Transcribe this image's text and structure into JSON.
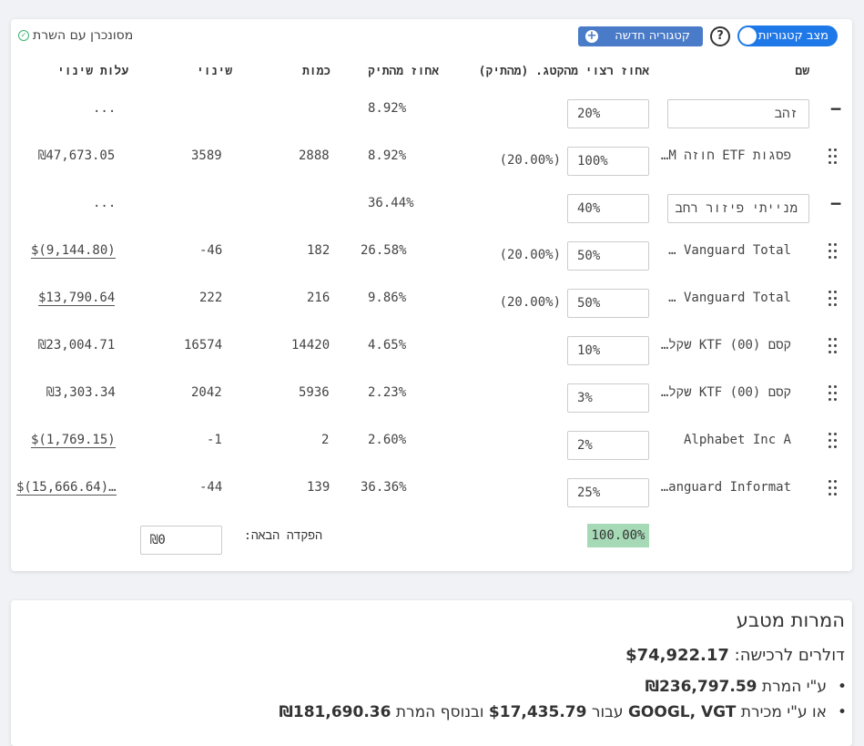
{
  "header": {
    "toggle_label": "מצב קטגוריות",
    "new_category_label": "קטגוריה חדשה",
    "help_symbol": "?",
    "sync_status": "מסונכרן עם השרת"
  },
  "columns": {
    "name": "שם",
    "desired_pct": "אחוז רצוי מהקטג. (מהתיק)",
    "portfolio_pct": "אחוז מהתיק",
    "quantity": "כמות",
    "change": "שינוי",
    "change_cost": "עלות שינוי"
  },
  "rows": [
    {
      "type": "category",
      "name": "זהב",
      "desired": "20%",
      "portfolio_pct": "8.92%",
      "change_cost": "..."
    },
    {
      "type": "holding",
      "name": "פסגות ETF חוזה M…",
      "desired": "100%",
      "sub": "(20.00%)",
      "portfolio_pct": "8.92%",
      "quantity": "2888",
      "change": "3589",
      "change_cost": "₪47,673.05"
    },
    {
      "type": "category",
      "name": "מנייתי פיזור רחב",
      "desired": "40%",
      "portfolio_pct": "36.44%",
      "change_cost": "..."
    },
    {
      "type": "holding",
      "name": "Vanguard Total …",
      "desired": "50%",
      "sub": "(20.00%)",
      "portfolio_pct": "26.58%",
      "quantity": "182",
      "change": "-46",
      "change_cost": "$(9,144.80)"
    },
    {
      "type": "holding",
      "name": "Vanguard Total …",
      "desired": "50%",
      "sub": "(20.00%)",
      "portfolio_pct": "9.86%",
      "quantity": "216",
      "change": "222",
      "change_cost": "$13,790.64"
    },
    {
      "type": "holding",
      "name": "קסם KTF (00) שקלי…",
      "desired": "10%",
      "portfolio_pct": "4.65%",
      "quantity": "14420",
      "change": "16574",
      "change_cost": "₪23,004.71"
    },
    {
      "type": "holding",
      "name": "קסם KTF (00) שקלי…",
      "desired": "3%",
      "portfolio_pct": "2.23%",
      "quantity": "5936",
      "change": "2042",
      "change_cost": "₪3,303.34"
    },
    {
      "type": "holding",
      "name": "Alphabet Inc A",
      "desired": "2%",
      "portfolio_pct": "2.60%",
      "quantity": "2",
      "change": "-1",
      "change_cost": "$(1,769.15)"
    },
    {
      "type": "holding",
      "name": "Vanguard Informat…",
      "desired": "25%",
      "portfolio_pct": "36.36%",
      "quantity": "139",
      "change": "-44",
      "change_cost": "$(15,666.64)…"
    }
  ],
  "footer": {
    "total_pct": "100.00%",
    "next_deposit_label": "הפקדה הבאה:",
    "next_deposit_value": "₪0"
  },
  "conversions": {
    "title": "המרות מטבע",
    "dollars_label": "דולרים לרכישה:",
    "dollars_value": "$74,922.17",
    "bullet1_prefix": "ע\"י המרת",
    "bullet1_value": "₪236,797.59",
    "bullet2_prefix": "או ע\"י מכירת",
    "bullet2_tickers": "GOOGL, VGT",
    "bullet2_mid": "עבור",
    "bullet2_amount": "$17,435.79",
    "bullet2_mid2": "ובנוסף המרת",
    "bullet2_value": "₪181,690.36"
  }
}
